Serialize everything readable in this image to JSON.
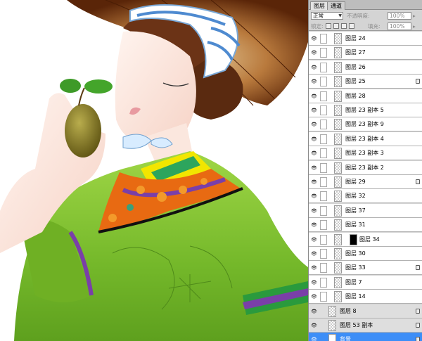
{
  "panel": {
    "tabs": [
      "图层",
      "通道"
    ],
    "blend_mode": "正常",
    "opacity_label": "不透明度:",
    "opacity_value": "100%",
    "lock_label": "锁定:",
    "fill_label": "填充:",
    "fill_value": "100%"
  },
  "layers": [
    {
      "name": "图层 24",
      "lock": false
    },
    {
      "name": "图层 27",
      "lock": false
    },
    {
      "name": "图层 26",
      "lock": false
    },
    {
      "name": "图层 25",
      "lock": true
    },
    {
      "name": "图层 28",
      "lock": false
    },
    {
      "name": "图层 23 副本 5",
      "lock": false
    },
    {
      "name": "图层 23 副本 9",
      "lock": false
    },
    {
      "name": "图层 23 副本 4",
      "lock": false
    },
    {
      "name": "图层 23 副本 3",
      "lock": false
    },
    {
      "name": "图层 23 副本 2",
      "lock": false
    },
    {
      "name": "图层 29",
      "lock": true
    },
    {
      "name": "图层 32",
      "lock": false
    },
    {
      "name": "图层 37",
      "lock": false
    },
    {
      "name": "图层 31",
      "lock": false
    },
    {
      "name": "图层 34",
      "lock": false
    },
    {
      "name": "图层 30",
      "lock": false
    },
    {
      "name": "图层 33",
      "lock": true
    },
    {
      "name": "图层 7",
      "lock": false
    },
    {
      "name": "图层 14",
      "lock": false
    },
    {
      "name": "图层 8",
      "lock": true
    },
    {
      "name": "图层 53 副本",
      "lock": true
    },
    {
      "name": "背景",
      "lock": true
    }
  ],
  "colors": {
    "selection": "#3d8ef7",
    "hat": "#8a3b12",
    "dress": "#7fc22e",
    "collar": "#f0e000",
    "kiwi": "#8a7d2a"
  }
}
